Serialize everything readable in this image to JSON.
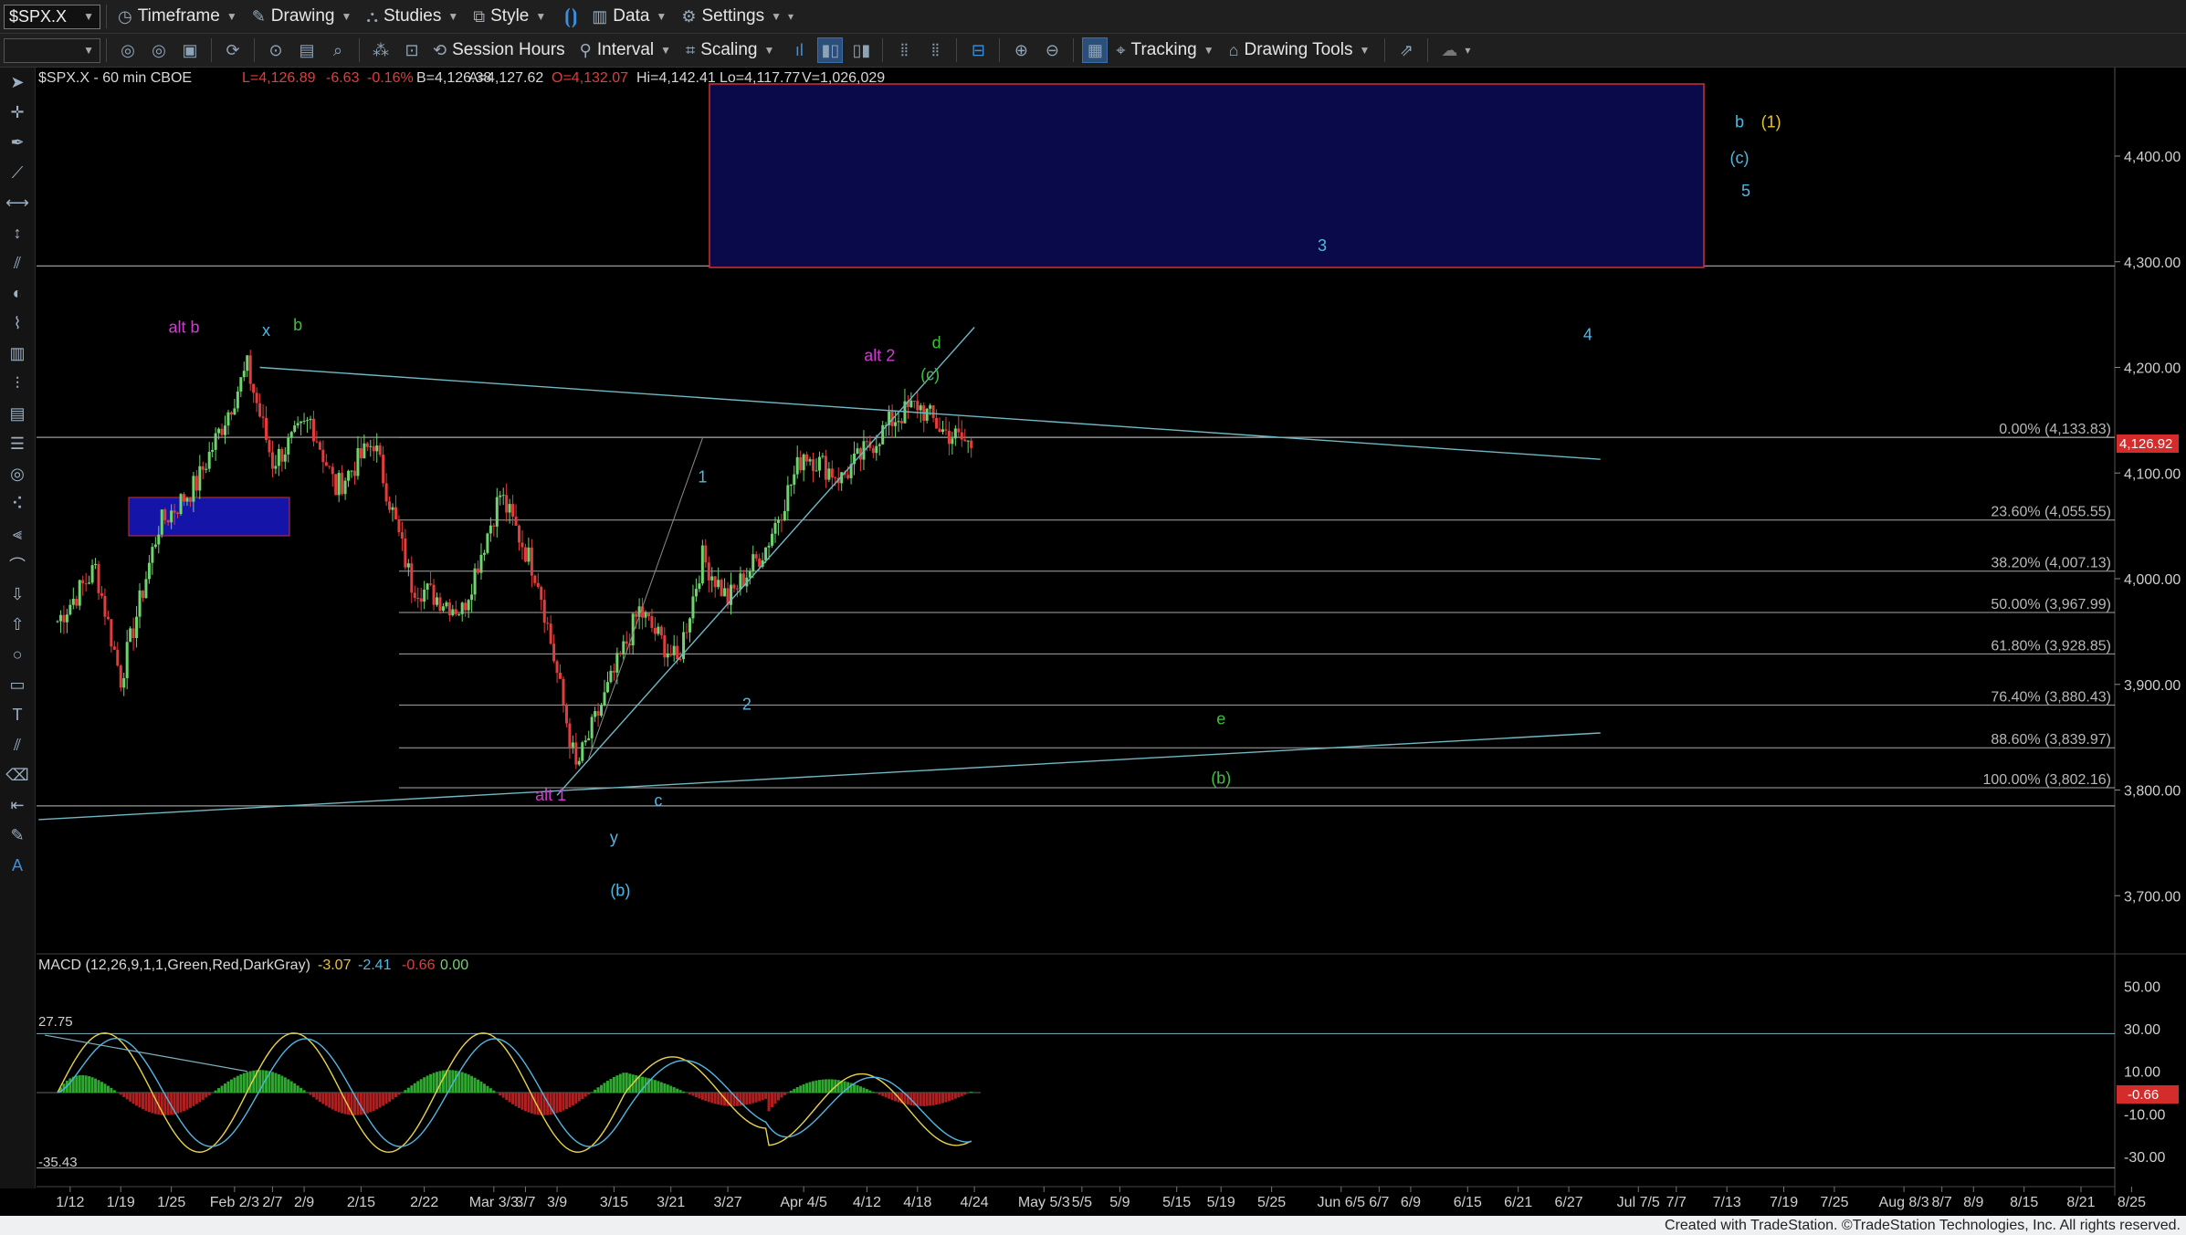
{
  "toolbar_top": {
    "symbol": "$SPX.X",
    "items": [
      {
        "label": "Timeframe",
        "icon": "clock-icon"
      },
      {
        "label": "Drawing",
        "icon": "pencil-icon"
      },
      {
        "label": "Studies",
        "icon": "studies-icon"
      },
      {
        "label": "Style",
        "icon": "style-icon"
      },
      {
        "label": "Data",
        "icon": "data-icon"
      },
      {
        "label": "Settings",
        "icon": "gear-icon"
      }
    ]
  },
  "toolbar_second": {
    "items": [
      {
        "label": "Session Hours",
        "icon": "session-icon"
      },
      {
        "label": "Interval",
        "icon": "interval-icon"
      },
      {
        "label": "Scaling",
        "icon": "scaling-icon"
      },
      {
        "label": "Tracking",
        "icon": "tracking-icon"
      },
      {
        "label": "Drawing Tools",
        "icon": "drawing-tools-icon"
      }
    ]
  },
  "chart_header": {
    "title": "$SPX.X - 60 min  CBOE",
    "last": "L=4,126.89",
    "change": "-6.63",
    "change_pct": "-0.16%",
    "bid": "B=4,126.38",
    "ask": "A=4,127.62",
    "open": "O=4,132.07",
    "high": "Hi=4,142.41",
    "low": "Lo=4,117.77",
    "volume": "V=1,026,029"
  },
  "colors": {
    "up": "#6fd36f",
    "down": "#e23c3c",
    "trendline": "#6fb8c4",
    "label_cyan": "#52b6e0",
    "label_magenta": "#d03cd0",
    "label_green": "#3fbf3f",
    "label_yellow": "#e8c42a",
    "fib": "#a7a7a7"
  },
  "price_axis": [
    "4,400.00",
    "4,300.00",
    "4,200.00",
    "4,100.00",
    "4,000.00",
    "3,900.00",
    "3,800.00",
    "3,700.00"
  ],
  "last_price_tag": "4,126.92",
  "fib_levels": [
    {
      "label": "0.00% (4,133.83)",
      "price": 4133.83
    },
    {
      "label": "23.60% (4,055.55)",
      "price": 4055.55
    },
    {
      "label": "38.20% (4,007.13)",
      "price": 4007.13
    },
    {
      "label": "50.00% (3,967.99)",
      "price": 3967.99
    },
    {
      "label": "61.80% (3,928.85)",
      "price": 3928.85
    },
    {
      "label": "76.40% (3,880.43)",
      "price": 3880.43
    },
    {
      "label": "88.60% (3,839.97)",
      "price": 3839.97
    },
    {
      "label": "100.00% (3,802.16)",
      "price": 3802.16
    }
  ],
  "wave_labels": [
    {
      "text": "alt b",
      "color": "label_magenta",
      "price": 4233,
      "xi": 10
    },
    {
      "text": "x",
      "color": "label_cyan",
      "price": 4230,
      "xi": 16.5
    },
    {
      "text": "b",
      "color": "label_green",
      "price": 4235,
      "xi": 19
    },
    {
      "text": "alt 2",
      "color": "label_magenta",
      "price": 4206,
      "xi": 65
    },
    {
      "text": "d",
      "color": "label_green",
      "price": 4218,
      "xi": 69.5
    },
    {
      "text": "(c)",
      "color": "label_green",
      "price": 4188,
      "xi": 69
    },
    {
      "text": "1",
      "color": "label_cyan",
      "price": 4091,
      "xi": 51
    },
    {
      "text": "2",
      "color": "label_cyan",
      "price": 3876,
      "xi": 54.5
    },
    {
      "text": "alt 1",
      "color": "label_magenta",
      "price": 3790,
      "xi": 39
    },
    {
      "text": "c",
      "color": "label_cyan",
      "price": 3785,
      "xi": 47.5
    },
    {
      "text": "y",
      "color": "label_cyan",
      "price": 3750,
      "xi": 44
    },
    {
      "text": "(b)",
      "color": "label_cyan",
      "price": 3700,
      "xi": 44.5
    },
    {
      "text": "e",
      "color": "label_green",
      "price": 3862,
      "xi": 92
    },
    {
      "text": "(b)",
      "color": "label_green",
      "price": 3806,
      "xi": 92
    },
    {
      "text": "3",
      "color": "label_cyan",
      "price": 4310,
      "xi": 100
    },
    {
      "text": "4",
      "color": "label_cyan",
      "price": 4226,
      "xi": 121
    },
    {
      "text": "b",
      "color": "label_cyan",
      "price": 4427,
      "xi": 133
    },
    {
      "text": "(1)",
      "color": "label_yellow",
      "price": 4427,
      "xi": 135.5
    },
    {
      "text": "(c)",
      "color": "label_cyan",
      "price": 4393,
      "xi": 133
    },
    {
      "text": "5",
      "color": "label_cyan",
      "price": 4362,
      "xi": 133.5
    }
  ],
  "x_axis": [
    {
      "label": "1/12",
      "xi": 1
    },
    {
      "label": "1/19",
      "xi": 5
    },
    {
      "label": "1/25",
      "xi": 9
    },
    {
      "label": "Feb 2/3",
      "xi": 14
    },
    {
      "label": "2/7",
      "xi": 17
    },
    {
      "label": "2/9",
      "xi": 19.5
    },
    {
      "label": "2/15",
      "xi": 24
    },
    {
      "label": "2/22",
      "xi": 29
    },
    {
      "label": "Mar 3/3",
      "xi": 34.5
    },
    {
      "label": "3/7",
      "xi": 37
    },
    {
      "label": "3/9",
      "xi": 39.5
    },
    {
      "label": "3/15",
      "xi": 44
    },
    {
      "label": "3/21",
      "xi": 48.5
    },
    {
      "label": "3/27",
      "xi": 53
    },
    {
      "label": "Apr 4/5",
      "xi": 59
    },
    {
      "label": "4/12",
      "xi": 64
    },
    {
      "label": "4/18",
      "xi": 68
    },
    {
      "label": "4/24",
      "xi": 72.5
    },
    {
      "label": "May 5/3",
      "xi": 78
    },
    {
      "label": "5/5",
      "xi": 81
    },
    {
      "label": "5/9",
      "xi": 84
    },
    {
      "label": "5/15",
      "xi": 88.5
    },
    {
      "label": "5/19",
      "xi": 92
    },
    {
      "label": "5/25",
      "xi": 96
    },
    {
      "label": "Jun 6/5",
      "xi": 101.5
    },
    {
      "label": "6/7",
      "xi": 104.5
    },
    {
      "label": "6/9",
      "xi": 107
    },
    {
      "label": "6/15",
      "xi": 111.5
    },
    {
      "label": "6/21",
      "xi": 115.5
    },
    {
      "label": "6/27",
      "xi": 119.5
    },
    {
      "label": "Jul 7/5",
      "xi": 125
    },
    {
      "label": "7/7",
      "xi": 128
    },
    {
      "label": "7/13",
      "xi": 132
    },
    {
      "label": "7/19",
      "xi": 136.5
    },
    {
      "label": "7/25",
      "xi": 140.5
    },
    {
      "label": "Aug 8/3",
      "xi": 146
    },
    {
      "label": "8/7",
      "xi": 149
    },
    {
      "label": "8/9",
      "xi": 151.5
    },
    {
      "label": "8/15",
      "xi": 155.5
    },
    {
      "label": "8/21",
      "xi": 160
    },
    {
      "label": "8/25",
      "xi": 164
    }
  ],
  "macd": {
    "label": "MACD (12,26,9,1,1,Green,Red,DarkGray)",
    "macd_value": "-3.07",
    "signal_value": "-2.41",
    "hist_value": "-0.66",
    "zero_value": "0.00",
    "upper_ref": "27.75",
    "lower_ref": "-35.43",
    "axis": [
      "50.00",
      "30.00",
      "10.00",
      "-10.00",
      "-30.00"
    ],
    "last_tag": "-0.66"
  },
  "footer": "Created with TradeStation. ©TradeStation Technologies, Inc. All rights reserved."
}
